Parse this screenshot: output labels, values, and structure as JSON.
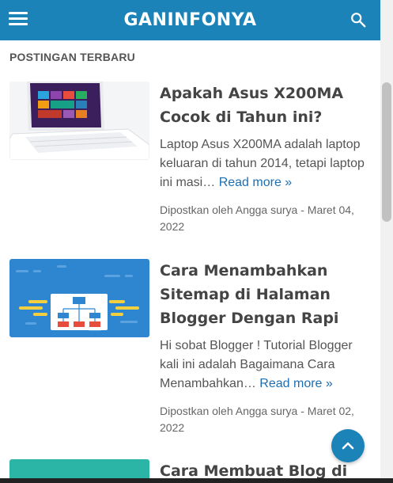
{
  "header": {
    "title": "GANINFONYA"
  },
  "section": {
    "title": "POSTINGAN TERBARU"
  },
  "posts": [
    {
      "title": "Apakah Asus X200MA Cocok di Tahun ini?",
      "excerpt": "Laptop Asus X200MA adalah laptop keluaran di tahun 2014, tetapi laptop ini masi…",
      "read_more": "Read more »",
      "meta": "Dipostkan oleh Angga surya",
      "date": "Maret 04, 2022"
    },
    {
      "title": "Cara Menambahkan Sitemap di Halaman Blogger Dengan Rapi",
      "excerpt": "Hi sobat Blogger ! Tutorial Blogger kali ini adalah Bagaimana Cara Menambahkan…",
      "read_more": "Read more »",
      "meta": "Dipostkan oleh Angga surya",
      "date": "Maret 02, 2022"
    },
    {
      "title": "Cara Membuat Blog di"
    }
  ],
  "icons": {
    "menu": "hamburger-menu-icon",
    "search": "search-icon",
    "scroll_top": "chevron-up-icon"
  },
  "colors": {
    "brand": "#1b83b8",
    "link": "#1b6fb5",
    "thumb_teal": "#2bb5a6"
  }
}
